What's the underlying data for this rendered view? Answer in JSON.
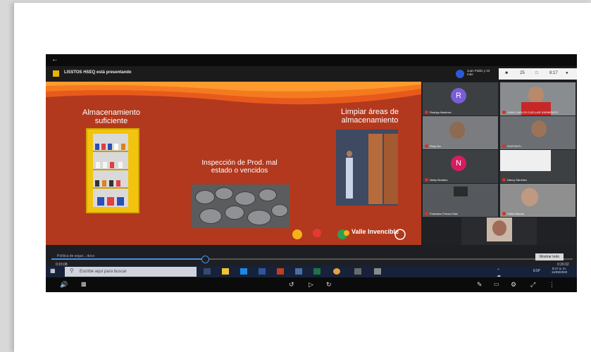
{
  "presenter_banner": "LISSTOS HSEQ está presentando",
  "presenter_user": "Juan Pablo y 23 más",
  "top_right": {
    "count": "25",
    "time": "8:17"
  },
  "slide": {
    "text_left": "Almacenamiento suficiente",
    "text_center": "Inspección de Prod. mal estado o vencidos",
    "text_right": "Limpiar áreas de almacenamiento",
    "logo_text": "Valle Invencible"
  },
  "participants": [
    {
      "name": "Rodrigo Martínez",
      "initial": "R",
      "color": "#7b5cd6"
    },
    {
      "name": "JUAN CARLOS CUELLAR SARMIENTO",
      "initial": "",
      "color": ""
    },
    {
      "name": "Rosy Ga",
      "initial": "",
      "color": ""
    },
    {
      "name": "GUSTAVO...",
      "initial": "",
      "color": ""
    },
    {
      "name": "Nelsy Morales",
      "initial": "N",
      "color": "#d81b60"
    },
    {
      "name": "Nancy Sánchez",
      "initial": "",
      "color": ""
    },
    {
      "name": "Francisco Franco Diaz",
      "initial": "",
      "color": ""
    },
    {
      "name": "Fabio Ramos",
      "initial": "",
      "color": ""
    },
    {
      "name": "JOSE NOLBERTO CALDERON OSSPENS",
      "initial": "",
      "color": ""
    }
  ],
  "media": {
    "title": "Política de segur... docx",
    "time_left": "0:15:08",
    "time_right": "0:26:02",
    "show_all": "Mostrar todo",
    "progress": 0.29
  },
  "taskbar": {
    "search_placeholder": "Escribe aquí para buscar",
    "lang": "ESP",
    "clock_time": "8:17 a. m.",
    "clock_date": "11/08/2020"
  }
}
